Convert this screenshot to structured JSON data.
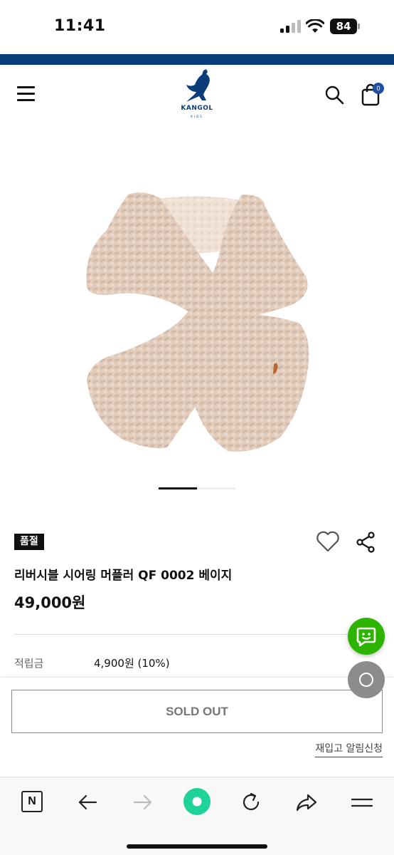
{
  "status_bar": {
    "time": "11:41",
    "battery": "84"
  },
  "header": {
    "logo_text": "KANGOL",
    "logo_sub": "KIDS",
    "cart_count": "0"
  },
  "product": {
    "soldout_badge": "품절",
    "name": "리버시블 시어링 머플러 QF 0002 베이지",
    "price": "49,000원",
    "points_label": "적립금",
    "points_value": "4,900원 (10%)",
    "carousel_progress": 0.5
  },
  "buy_bar": {
    "soldout_button": "SOLD OUT",
    "restock_link": "재입고 알림신청"
  },
  "browser_toolbar": {
    "naver_label": "N"
  },
  "colors": {
    "brand_blue": "#0a3d7a",
    "chat_green": "#2db400",
    "cart_badge": "#1f4ea3"
  }
}
